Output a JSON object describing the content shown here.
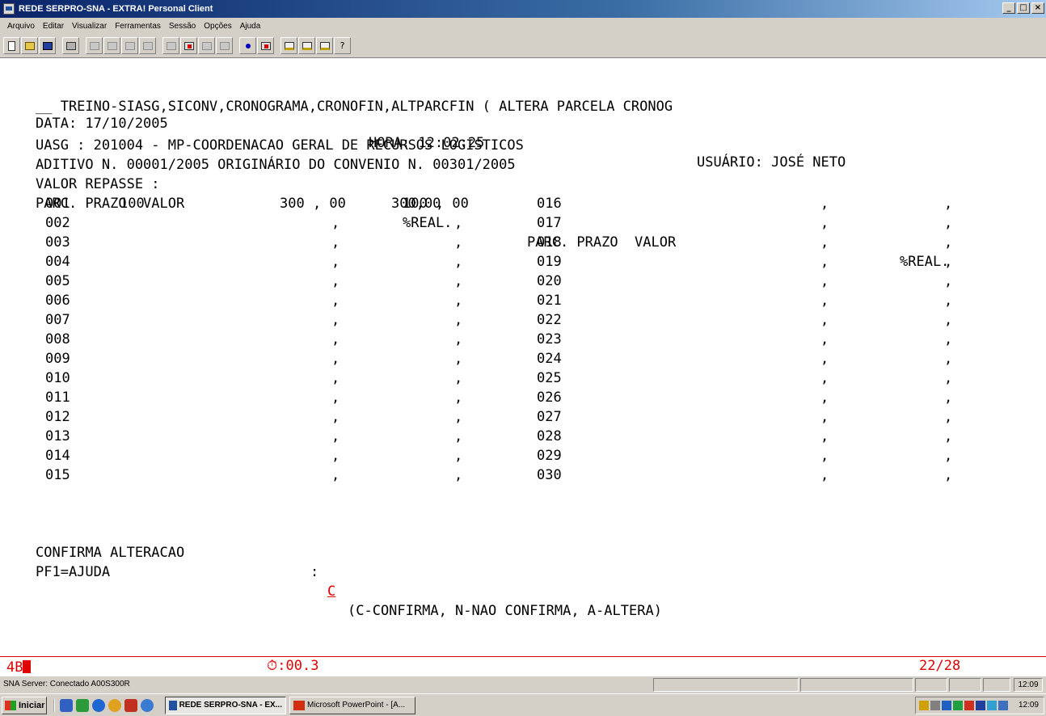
{
  "window": {
    "title": "REDE SERPRO-SNA - EXTRA! Personal Client",
    "buttons": [
      "_",
      "□",
      "×"
    ]
  },
  "menu": [
    "Arquivo",
    "Editar",
    "Visualizar",
    "Ferramentas",
    "Sessão",
    "Opções",
    "Ajuda"
  ],
  "toolbar": {
    "icons": [
      "new-icon",
      "open-icon",
      "save-icon",
      "print-icon",
      "cut-icon",
      "copy-icon",
      "paste-icon",
      "trace-icon",
      "quickpad-icon",
      "macro-icon",
      "session-icon",
      "transfer-icon",
      "connect-icon",
      "disconnect-icon",
      "chart-icon",
      "chart2-icon",
      "chart3-icon",
      "help-icon"
    ],
    "help_glyph": "?"
  },
  "terminal": {
    "line1": "__ TREINO-SIASG,SICONV,CRONOGRAMA,CRONOFIN,ALTPARCFIN ( ALTERA PARCELA CRONOG",
    "data_label": "DATA: 17/10/2005",
    "hora_label": "HORA: 12:02:25",
    "usuario_label": "USUÁRIO: JOSÉ NETO",
    "uasg": "UASG : 201004 - MP-COORDENACAO GERAL DE RECURSOS LOGISTICOS",
    "aditivo": "ADITIVO N. 00001/2005 ORIGINÁRIO DO CONVENIO N. 00301/2005",
    "repasse_label": "VALOR REPASSE :",
    "repasse_value": "300,00",
    "left_header": "PARC. PRAZO  VALOR",
    "left_header_real": "%REAL.",
    "right_header": "PARC. PRAZO  VALOR",
    "right_header_real": "%REAL.",
    "left_rows": [
      {
        "parc": "001",
        "prazo": "100",
        "valor": "300 , 00",
        "real": "100 , 00"
      },
      {
        "parc": "002",
        "prazo": "",
        "valor": ",",
        "real": ","
      },
      {
        "parc": "003",
        "prazo": "",
        "valor": ",",
        "real": ","
      },
      {
        "parc": "004",
        "prazo": "",
        "valor": ",",
        "real": ","
      },
      {
        "parc": "005",
        "prazo": "",
        "valor": ",",
        "real": ","
      },
      {
        "parc": "006",
        "prazo": "",
        "valor": ",",
        "real": ","
      },
      {
        "parc": "007",
        "prazo": "",
        "valor": ",",
        "real": ","
      },
      {
        "parc": "008",
        "prazo": "",
        "valor": ",",
        "real": ","
      },
      {
        "parc": "009",
        "prazo": "",
        "valor": ",",
        "real": ","
      },
      {
        "parc": "010",
        "prazo": "",
        "valor": ",",
        "real": ","
      },
      {
        "parc": "011",
        "prazo": "",
        "valor": ",",
        "real": ","
      },
      {
        "parc": "012",
        "prazo": "",
        "valor": ",",
        "real": ","
      },
      {
        "parc": "013",
        "prazo": "",
        "valor": ",",
        "real": ","
      },
      {
        "parc": "014",
        "prazo": "",
        "valor": ",",
        "real": ","
      },
      {
        "parc": "015",
        "prazo": "",
        "valor": ",",
        "real": ","
      }
    ],
    "right_rows": [
      {
        "parc": "016",
        "valor": ",",
        "real": ","
      },
      {
        "parc": "017",
        "valor": ",",
        "real": ","
      },
      {
        "parc": "018",
        "valor": ",",
        "real": ","
      },
      {
        "parc": "019",
        "valor": ",",
        "real": ","
      },
      {
        "parc": "020",
        "valor": ",",
        "real": ","
      },
      {
        "parc": "021",
        "valor": ",",
        "real": ","
      },
      {
        "parc": "022",
        "valor": ",",
        "real": ","
      },
      {
        "parc": "023",
        "valor": ",",
        "real": ","
      },
      {
        "parc": "024",
        "valor": ",",
        "real": ","
      },
      {
        "parc": "025",
        "valor": ",",
        "real": ","
      },
      {
        "parc": "026",
        "valor": ",",
        "real": ","
      },
      {
        "parc": "027",
        "valor": ",",
        "real": ","
      },
      {
        "parc": "028",
        "valor": ",",
        "real": ","
      },
      {
        "parc": "029",
        "valor": ",",
        "real": ","
      },
      {
        "parc": "030",
        "valor": ",",
        "real": ","
      }
    ],
    "confirma_label": "CONFIRMA ALTERACAO",
    "confirma_colon": ":",
    "confirma_value": "C",
    "confirma_options": "(C-CONFIRMA, N-NAO CONFIRMA, A-ALTERA)",
    "pf1": "PF1=AJUDA"
  },
  "oia": {
    "indicator": "4B",
    "timer": "⏱:00.3",
    "cursor_pos": "22/28"
  },
  "statusbar": {
    "message": "SNA Server: Conectado A00S300R",
    "clock": "12:09"
  },
  "taskbar": {
    "start": "Iniciar",
    "tasks": [
      "REDE SERPRO-SNA - EX...",
      "Microsoft PowerPoint - [A..."
    ],
    "time": "12:09"
  },
  "colors": {
    "accent_red": "#e00000",
    "title_blue": "#0a246a",
    "chrome_gray": "#d4d0c8"
  }
}
